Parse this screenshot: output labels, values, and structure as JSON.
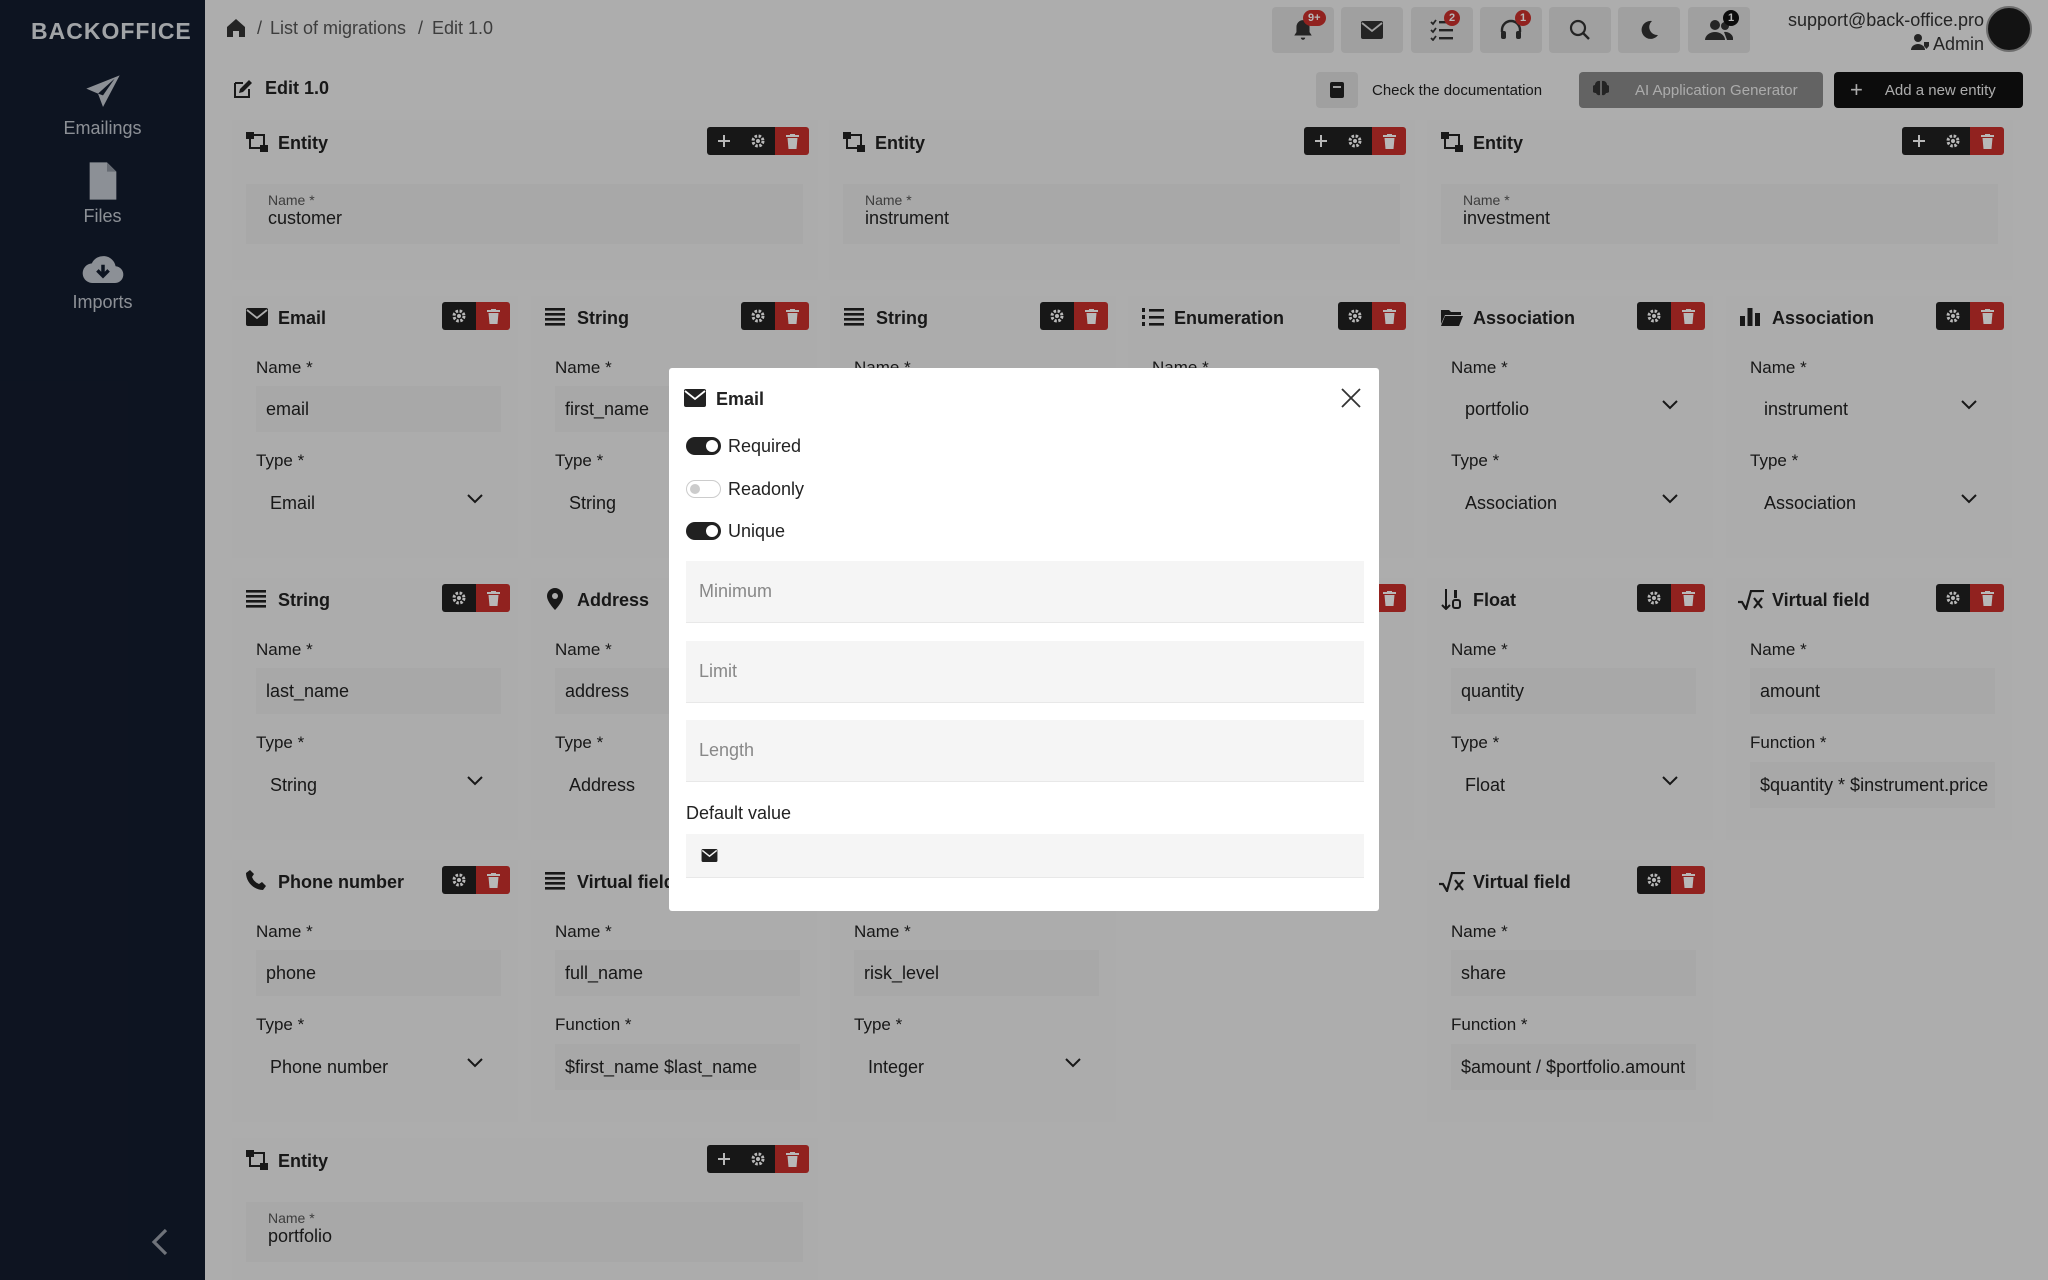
{
  "sidebar": {
    "brand": "BACKOFFICE",
    "items": [
      {
        "label": "Emailings",
        "icon": "paper-plane-icon"
      },
      {
        "label": "Files",
        "icon": "file-icon"
      },
      {
        "label": "Imports",
        "icon": "cloud-download-icon"
      }
    ]
  },
  "breadcrumb": {
    "items": [
      "List of migrations",
      "Edit 1.0"
    ]
  },
  "topbar": {
    "notifications_badge": "9+",
    "tasks_badge": "2",
    "support_badge": "1",
    "users_badge": "1",
    "user_email": "support@back-office.pro",
    "user_role": "Admin"
  },
  "page": {
    "title": "Edit 1.0",
    "doc_button": "Check the documentation",
    "ai_button": "AI Application Generator",
    "add_button": "Add a new entity"
  },
  "entities": [
    {
      "title": "Entity",
      "name_label": "Name *",
      "name_value": "customer"
    },
    {
      "title": "Entity",
      "name_label": "Name *",
      "name_value": "instrument"
    },
    {
      "title": "Entity",
      "name_label": "Name *",
      "name_value": "investment"
    },
    {
      "title": "Entity",
      "name_label": "Name *",
      "name_value": "portfolio"
    }
  ],
  "fields": [
    {
      "title": "Email",
      "name_label": "Name *",
      "name_value": "email",
      "second_label": "Type *",
      "second_value": "Email"
    },
    {
      "title": "String",
      "name_label": "Name *",
      "name_value": "first_name",
      "second_label": "Type *",
      "second_value": "String"
    },
    {
      "title": "String",
      "name_label": "Name *"
    },
    {
      "title": "Enumeration",
      "name_label": "Name *"
    },
    {
      "title": "Association",
      "name_label": "Name *",
      "name_value": "portfolio",
      "second_label": "Type *",
      "second_value": "Association"
    },
    {
      "title": "Association",
      "name_label": "Name *",
      "name_value": "instrument",
      "second_label": "Type *",
      "second_value": "Association"
    },
    {
      "title": "String",
      "name_label": "Name *",
      "name_value": "last_name",
      "second_label": "Type *",
      "second_value": "String"
    },
    {
      "title": "Address",
      "name_label": "Name *",
      "name_value": "address",
      "second_label": "Type *",
      "second_value": "Address"
    },
    {
      "title": "Float",
      "name_label": "Name *",
      "name_value": "quantity",
      "second_label": "Type *",
      "second_value": "Float"
    },
    {
      "title": "Virtual field",
      "name_label": "Name *",
      "name_value": "amount",
      "second_label": "Function *",
      "second_value": "$quantity * $instrument.price"
    },
    {
      "title": "Phone number",
      "name_label": "Name *",
      "name_value": "phone",
      "second_label": "Type *",
      "second_value": "Phone number"
    },
    {
      "title": "Virtual field",
      "name_label": "Name *",
      "name_value": "full_name",
      "second_label": "Function *",
      "second_value": "$first_name $last_name"
    },
    {
      "name_label": "Name *",
      "name_value": "risk_level",
      "second_label": "Type *",
      "second_value": "Integer"
    },
    {
      "title": "Virtual field",
      "name_label": "Name *",
      "name_value": "share",
      "second_label": "Function *",
      "second_value": "$amount / $portfolio.amount"
    }
  ],
  "modal": {
    "title": "Email",
    "toggles": [
      {
        "label": "Required",
        "on": true
      },
      {
        "label": "Readonly",
        "on": false
      },
      {
        "label": "Unique",
        "on": true
      }
    ],
    "inputs": {
      "minimum": "Minimum",
      "limit": "Limit",
      "length": "Length"
    },
    "default_label": "Default value"
  }
}
